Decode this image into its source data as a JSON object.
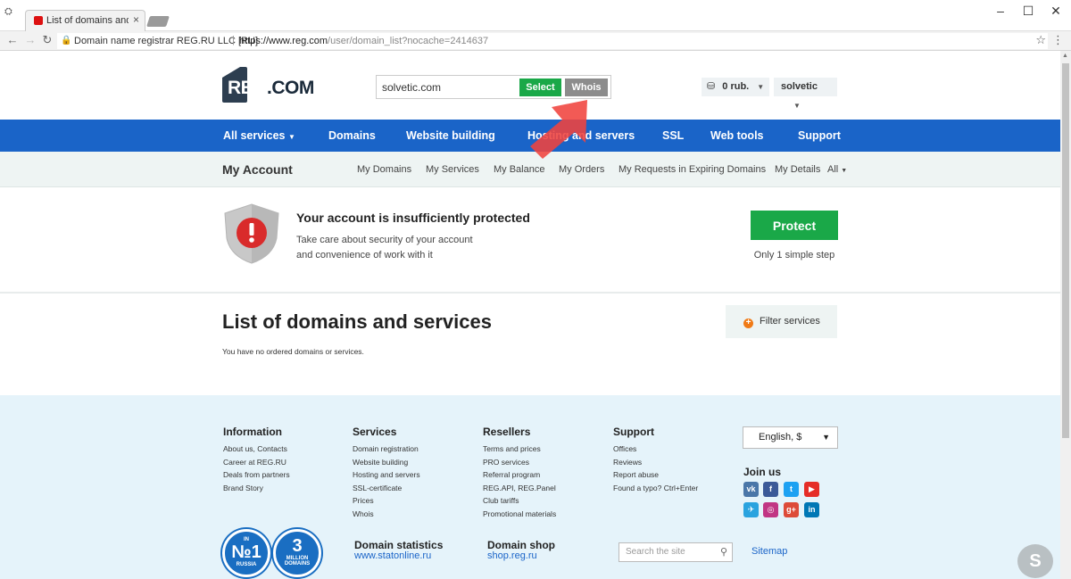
{
  "browser": {
    "tab_title": "List of domains and servi",
    "tab_close": "×",
    "site_identity": "Domain name registrar REG.RU LLC [RU]",
    "separator": "|",
    "url_scheme_host": "https://www.reg.com",
    "url_path": "/user/domain_list?nocache=2414637",
    "minimize": "–",
    "maximize": "☐",
    "close": "✕"
  },
  "header": {
    "logo_reg": "REG",
    "logo_com": ".COM",
    "search_value": "solvetic.com",
    "select_label": "Select",
    "whois_label": "Whois",
    "balance": "0 rub.",
    "username": "solvetic"
  },
  "main_nav": {
    "items": [
      "All services",
      "Domains",
      "Website building",
      "Hosting and servers",
      "SSL",
      "Web tools",
      "Support"
    ]
  },
  "account_nav": {
    "title": "My Account",
    "links": [
      "My Domains",
      "My Services",
      "My Balance",
      "My Orders",
      "My Requests in Expiring Domains",
      "My Details",
      "All"
    ]
  },
  "security": {
    "title": "Your account is insufficiently protected",
    "line1": "Take care about security of your account",
    "line2": "and convenience of work with it",
    "button": "Protect",
    "note": "Only 1 simple step"
  },
  "domains": {
    "title": "List of domains and services",
    "filter_label": "Filter services",
    "empty_text": "You have no ordered domains or services."
  },
  "footer": {
    "columns": [
      {
        "title": "Information",
        "links": [
          "About us, Contacts",
          "Career at REG.RU",
          "Deals from partners",
          "Brand Story"
        ]
      },
      {
        "title": "Services",
        "links": [
          "Domain registration",
          "Website building",
          "Hosting and servers",
          "SSL-certificate",
          "Prices",
          "Whois"
        ]
      },
      {
        "title": "Resellers",
        "links": [
          "Terms and prices",
          "PRO services",
          "Referral program",
          "REG.API, REG.Panel",
          "Club tariffs",
          "Promotional materials"
        ]
      },
      {
        "title": "Support",
        "links": [
          "Offices",
          "Reviews",
          "Report abuse",
          "Found a typo? Ctrl+Enter"
        ]
      }
    ],
    "language": "English, $",
    "join_us": "Join us",
    "badge1": {
      "big": "№1",
      "small_top": "IN",
      "small_bottom": "RUSSIA"
    },
    "badge2": {
      "big": "3",
      "small_top": "MILLION",
      "small_bottom": "DOMAINS"
    },
    "stats_title": "Domain statistics",
    "stats_link": "www.statonline.ru",
    "shop_title": "Domain shop",
    "shop_link": "shop.reg.ru",
    "search_placeholder": "Search the site",
    "sitemap": "Sitemap"
  },
  "social": [
    {
      "icon": "vk-icon",
      "label": "vk",
      "color": "#4a76a8"
    },
    {
      "icon": "facebook-icon",
      "label": "f",
      "color": "#3b5998"
    },
    {
      "icon": "twitter-icon",
      "label": "t",
      "color": "#1da1f2"
    },
    {
      "icon": "youtube-icon",
      "label": "▶",
      "color": "#e52d27"
    },
    {
      "icon": "telegram-icon",
      "label": "✈",
      "color": "#2aa3df"
    },
    {
      "icon": "instagram-icon",
      "label": "◎",
      "color": "#c13584"
    },
    {
      "icon": "google-plus-icon",
      "label": "g+",
      "color": "#dd4b39"
    },
    {
      "icon": "linkedin-icon",
      "label": "in",
      "color": "#0077b5"
    }
  ],
  "watermark": "S"
}
